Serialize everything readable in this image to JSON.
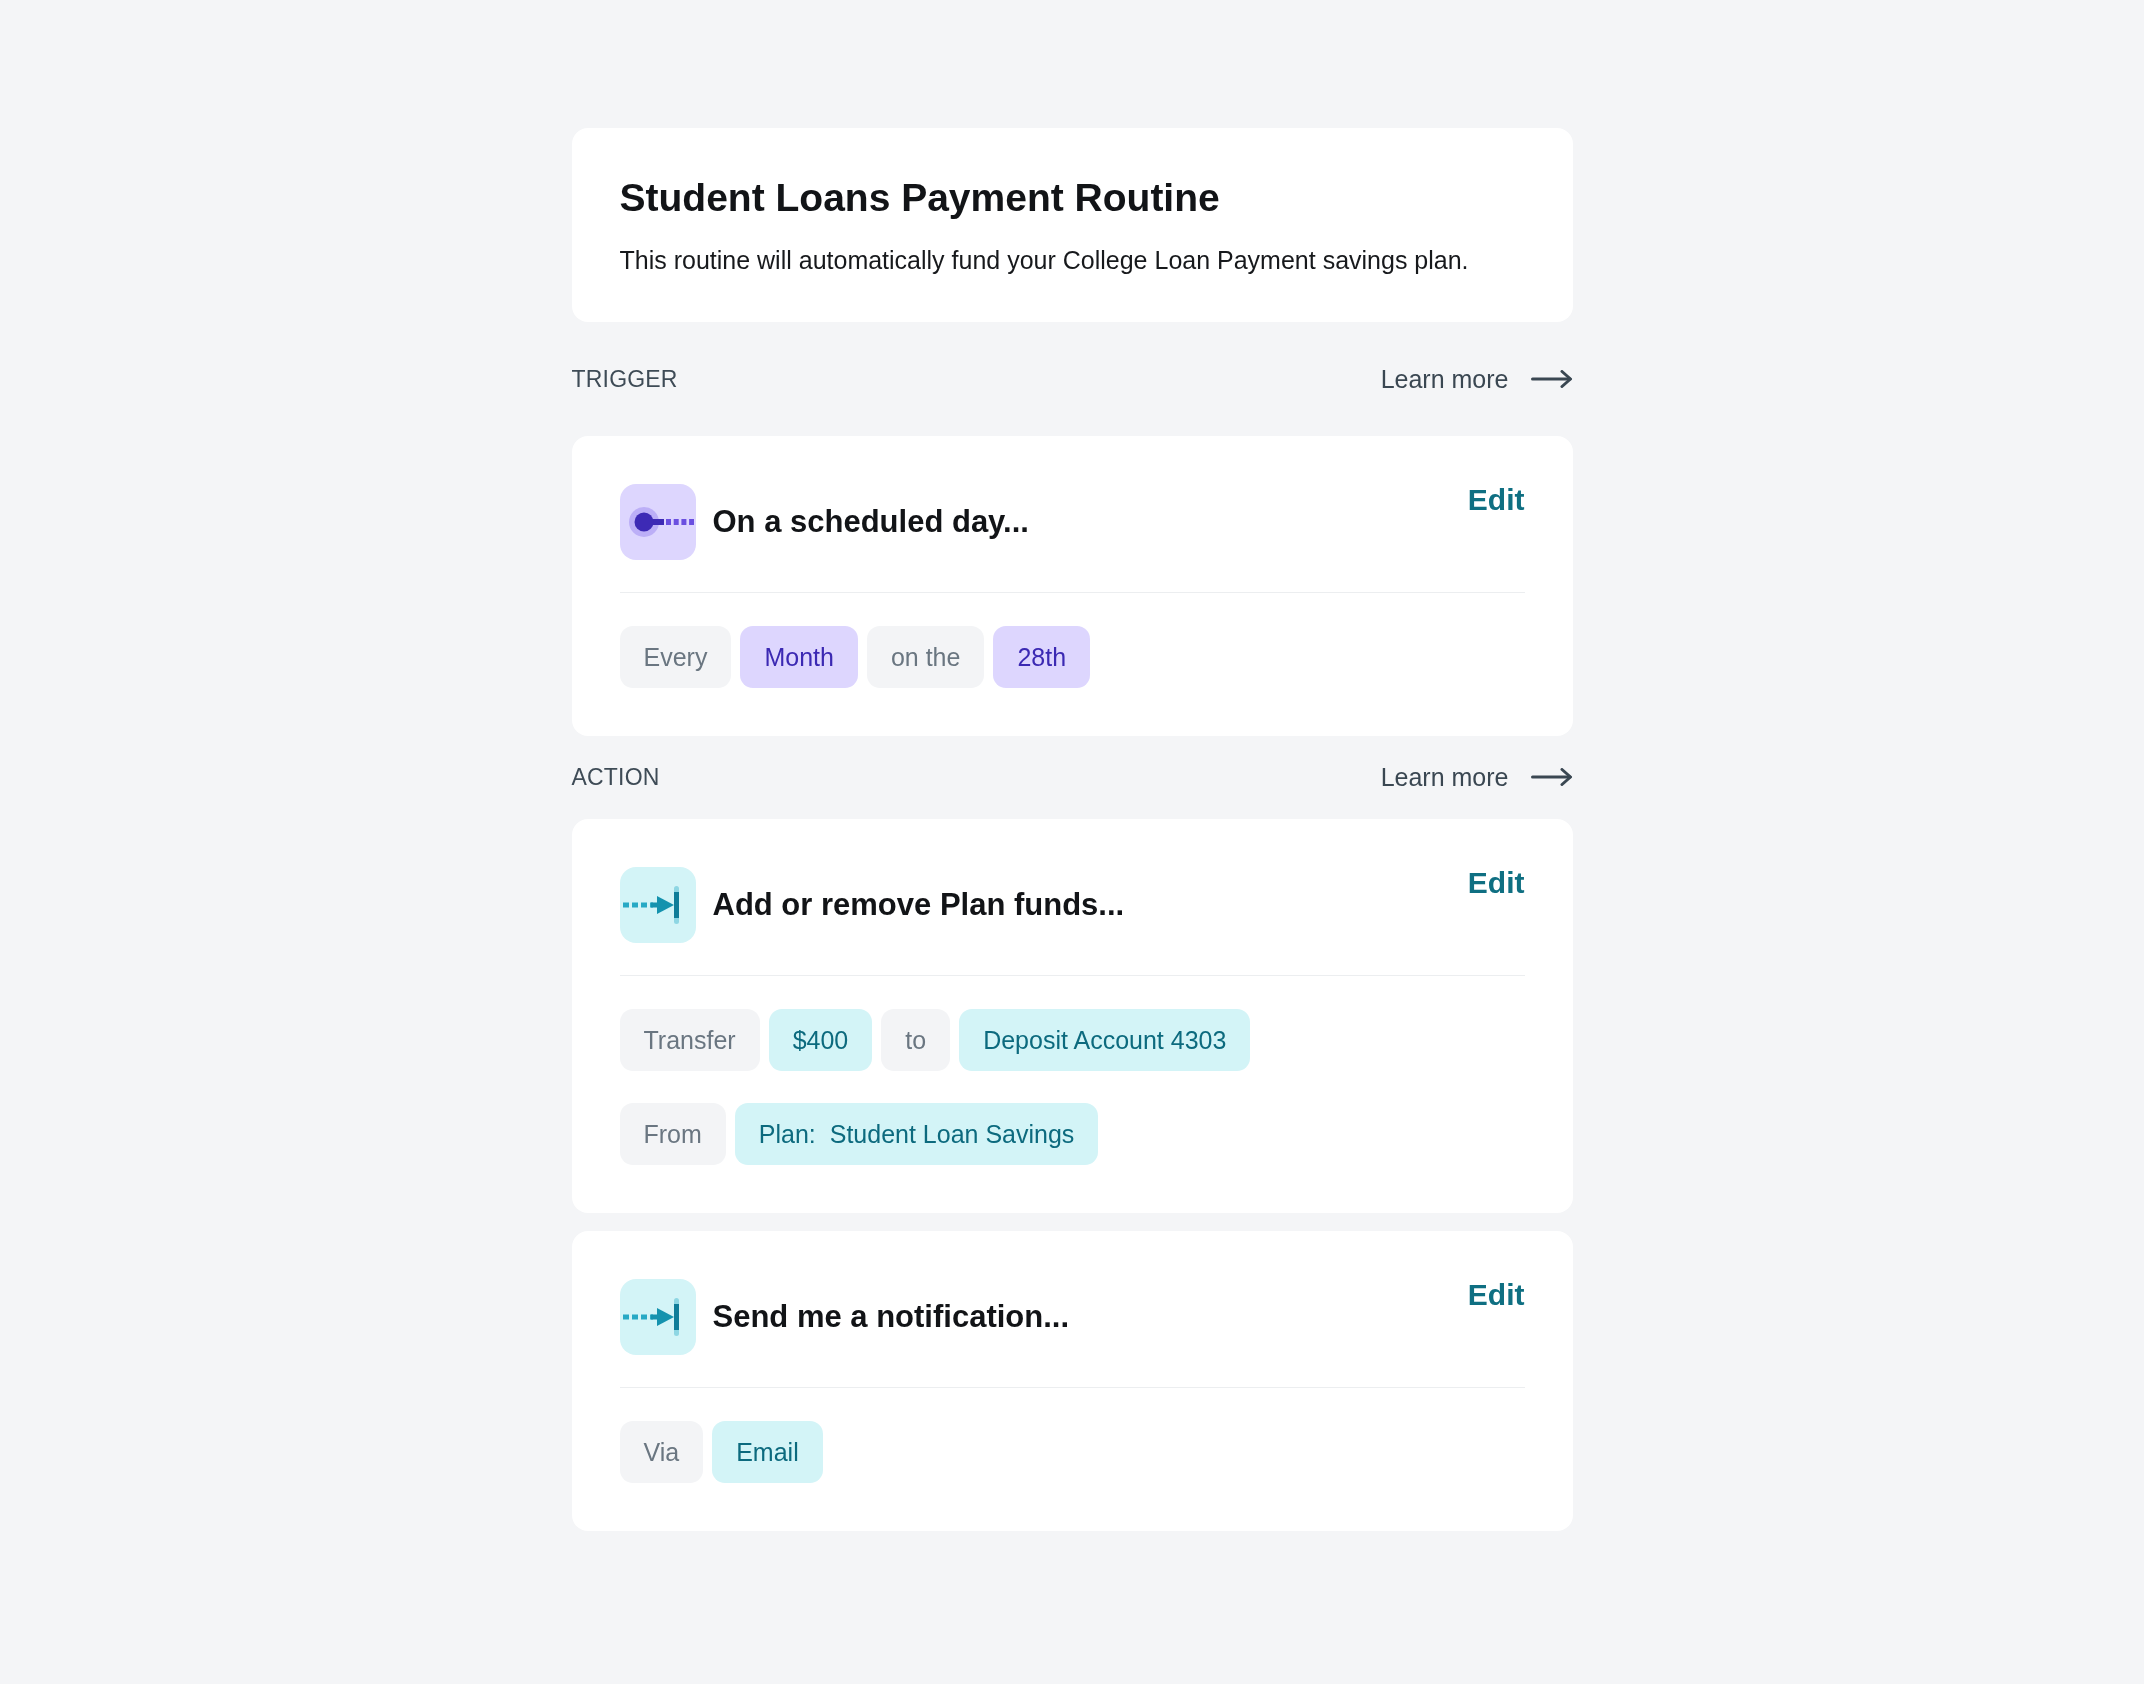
{
  "routine": {
    "title": "Student Loans Payment Routine",
    "description": "This routine will automatically fund your College Loan Payment savings plan."
  },
  "sections": [
    {
      "label": "TRIGGER",
      "link": "Learn more",
      "steps": [
        {
          "kind": "trigger",
          "title": "On a scheduled day...",
          "edit": "Edit",
          "rows": [
            {
              "chips": [
                {
                  "kind": "keyword",
                  "text": "Every"
                },
                {
                  "kind": "value",
                  "text": "Month"
                },
                {
                  "kind": "keyword",
                  "text": "on the"
                },
                {
                  "kind": "value",
                  "text": "28th"
                }
              ]
            }
          ]
        }
      ]
    },
    {
      "label": "ACTION",
      "link": "Learn more",
      "steps": [
        {
          "kind": "action",
          "title": "Add or remove Plan funds...",
          "edit": "Edit",
          "rows": [
            {
              "chips": [
                {
                  "kind": "keyword",
                  "text": "Transfer"
                },
                {
                  "kind": "value",
                  "text": "$400"
                },
                {
                  "kind": "keyword",
                  "text": "to"
                },
                {
                  "kind": "value",
                  "text": "Deposit Account 4303"
                }
              ]
            },
            {
              "chips": [
                {
                  "kind": "keyword",
                  "text": "From"
                },
                {
                  "kind": "value",
                  "text": "Plan:  Student Loan Savings"
                }
              ]
            }
          ]
        },
        {
          "kind": "action",
          "title": "Send me a notification...",
          "edit": "Edit",
          "rows": [
            {
              "chips": [
                {
                  "kind": "keyword",
                  "text": "Via"
                },
                {
                  "kind": "value",
                  "text": "Email"
                }
              ]
            }
          ]
        }
      ]
    }
  ]
}
